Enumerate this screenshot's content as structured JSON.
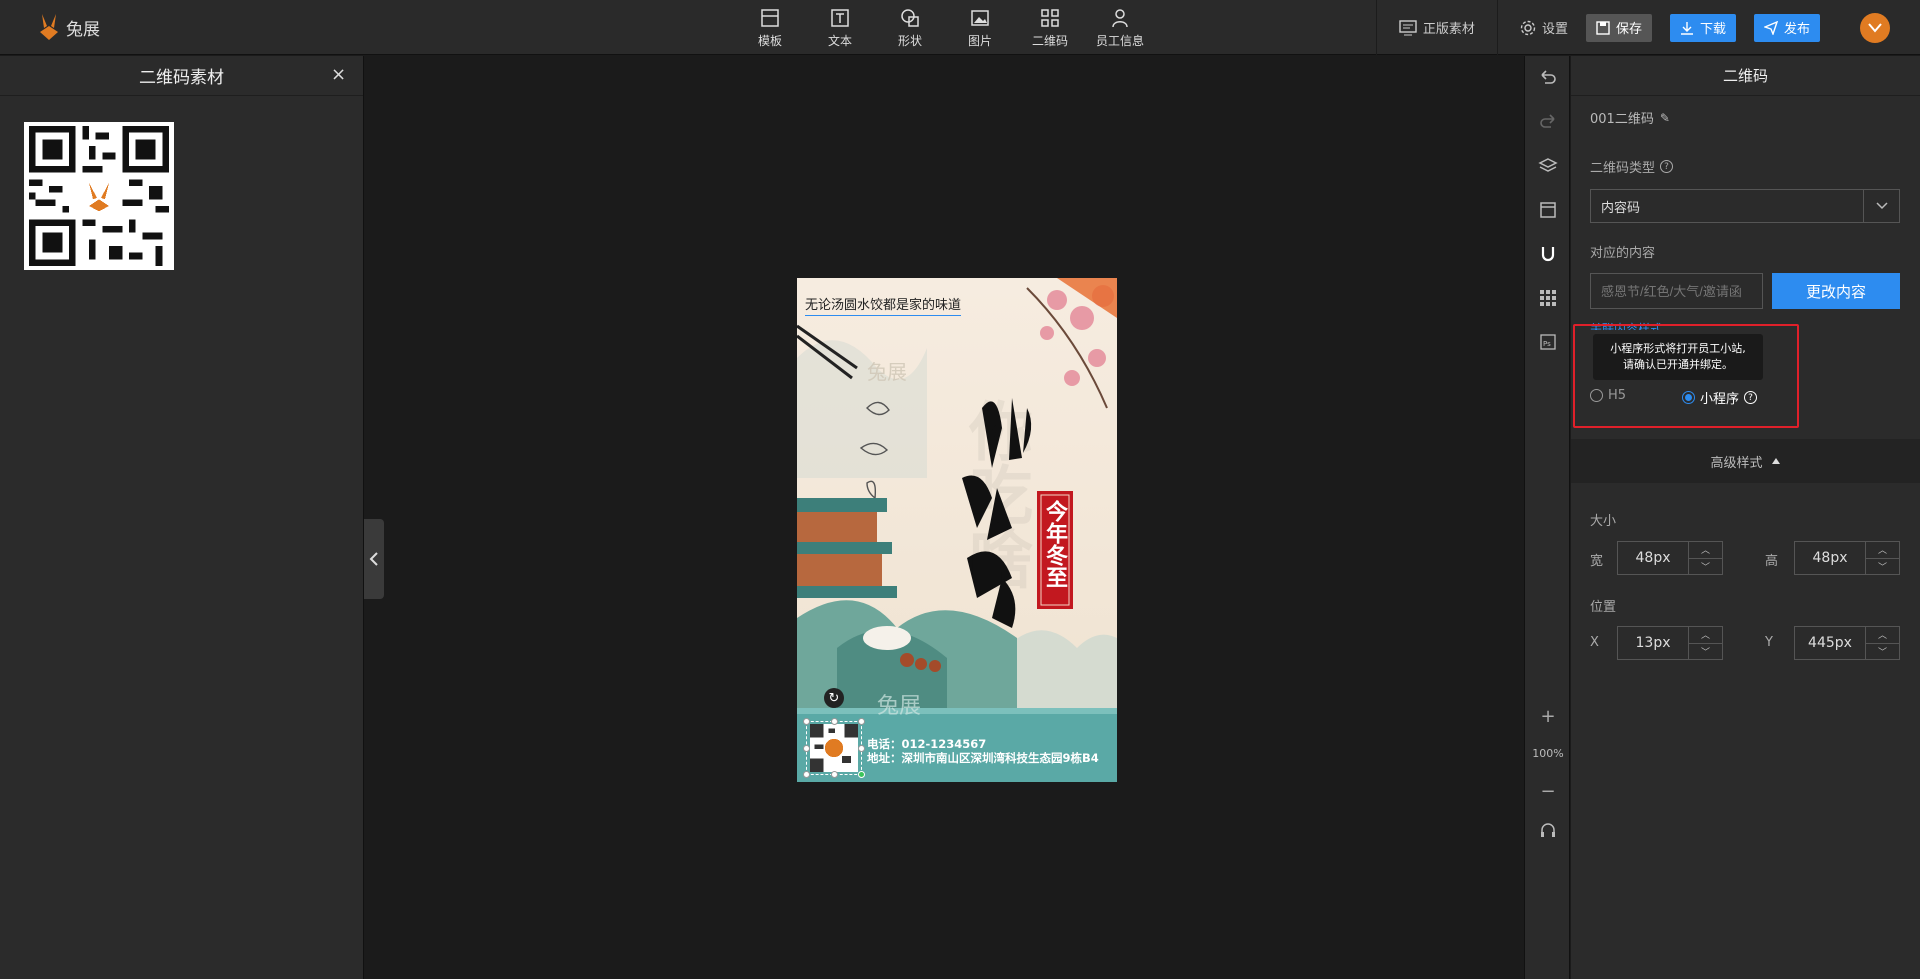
{
  "app": {
    "logo_text": "兔展"
  },
  "toolbar": {
    "items": [
      {
        "label": "模板",
        "icon": "template-icon"
      },
      {
        "label": "文本",
        "icon": "text-icon"
      },
      {
        "label": "形状",
        "icon": "shape-icon"
      },
      {
        "label": "图片",
        "icon": "image-icon"
      },
      {
        "label": "二维码",
        "icon": "qrcode-icon"
      },
      {
        "label": "员工信息",
        "icon": "user-icon"
      }
    ],
    "licensed_assets": "正版素材",
    "settings": "设置",
    "save": "保存",
    "download": "下载",
    "publish": "发布"
  },
  "left_panel": {
    "title": "二维码素材"
  },
  "poster": {
    "tagline": "无论汤圆水饺都是家的味道",
    "big_title": "你吃啥",
    "seal_text": "今年冬至",
    "phone": "电话：012-1234567",
    "address": "地址：深圳市南山区深圳湾科技生态园9栋B4",
    "watermark": "兔展"
  },
  "rail": {
    "zoom": "100%"
  },
  "props": {
    "title": "二维码",
    "element_name": "001二维码",
    "type_label": "二维码类型",
    "type_value": "内容码",
    "content_label": "对应的内容",
    "content_placeholder": "感恩节/红色/大气/邀请函",
    "change_button": "更改内容",
    "link_style_label": "关联内容样式",
    "tooltip_line1": "小程序形式将打开员工小站,",
    "tooltip_line2": "请确认已开通并绑定。",
    "radio_h5": "H5",
    "radio_mini": "小程序",
    "advanced": "高级样式",
    "size_label": "大小",
    "width_label": "宽",
    "width_value": "48px",
    "height_label": "高",
    "height_value": "48px",
    "position_label": "位置",
    "x_label": "X",
    "x_value": "13px",
    "y_label": "Y",
    "y_value": "445px"
  },
  "colors": {
    "accent": "#2d8cf0",
    "highlight": "#e0202a",
    "brand": "#e07b22"
  }
}
